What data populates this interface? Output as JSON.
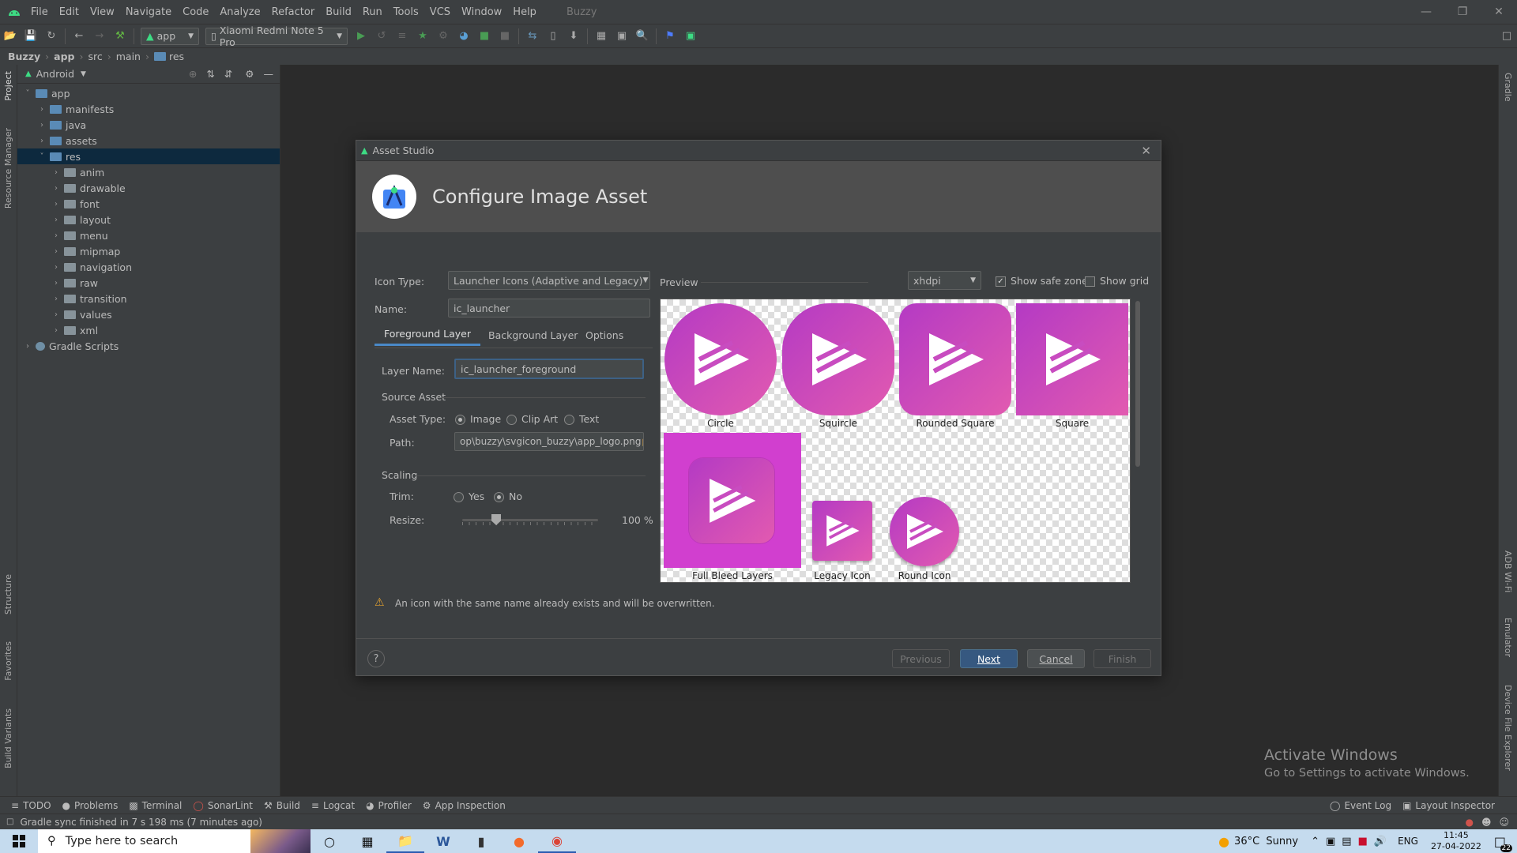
{
  "menubar": {
    "items": [
      "File",
      "Edit",
      "View",
      "Navigate",
      "Code",
      "Analyze",
      "Refactor",
      "Build",
      "Run",
      "Tools",
      "VCS",
      "Window",
      "Help"
    ],
    "project_name": "Buzzy"
  },
  "toolbar": {
    "module": "app",
    "device": "Xiaomi Redmi Note 5 Pro"
  },
  "breadcrumb": [
    "Buzzy",
    "app",
    "src",
    "main",
    "res"
  ],
  "project_panel": {
    "view_mode": "Android",
    "tree": [
      {
        "label": "app",
        "level": 0,
        "expanded": true
      },
      {
        "label": "manifests",
        "level": 1
      },
      {
        "label": "java",
        "level": 1
      },
      {
        "label": "assets",
        "level": 1
      },
      {
        "label": "res",
        "level": 1,
        "expanded": true,
        "selected": true
      },
      {
        "label": "anim",
        "level": 2
      },
      {
        "label": "drawable",
        "level": 2
      },
      {
        "label": "font",
        "level": 2
      },
      {
        "label": "layout",
        "level": 2
      },
      {
        "label": "menu",
        "level": 2
      },
      {
        "label": "mipmap",
        "level": 2
      },
      {
        "label": "navigation",
        "level": 2
      },
      {
        "label": "raw",
        "level": 2
      },
      {
        "label": "transition",
        "level": 2
      },
      {
        "label": "values",
        "level": 2
      },
      {
        "label": "xml",
        "level": 2
      },
      {
        "label": "Gradle Scripts",
        "level": 0
      }
    ]
  },
  "left_strip": {
    "project": "Project",
    "resource_manager": "Resource Manager",
    "structure": "Structure",
    "favorites": "Favorites",
    "build_variants": "Build Variants"
  },
  "right_strip": {
    "gradle": "Gradle",
    "adb_wifi": "ADB Wi-Fi",
    "emulator": "Emulator",
    "device_file_explorer": "Device File Explorer"
  },
  "dialog": {
    "window_title": "Asset Studio",
    "heading": "Configure Image Asset",
    "icon_type_label": "Icon Type:",
    "icon_type_value": "Launcher Icons (Adaptive and Legacy)",
    "name_label": "Name:",
    "name_value": "ic_launcher",
    "tabs": [
      "Foreground Layer",
      "Background Layer",
      "Options"
    ],
    "layer_name_label": "Layer Name:",
    "layer_name_value": "ic_launcher_foreground",
    "source_asset_label": "Source Asset",
    "asset_type_label": "Asset Type:",
    "asset_types": [
      "Image",
      "Clip Art",
      "Text"
    ],
    "path_label": "Path:",
    "path_value": "op\\buzzy\\svgicon_buzzy\\app_logo.png",
    "scaling_label": "Scaling",
    "trim_label": "Trim:",
    "trim_options": [
      "Yes",
      "No"
    ],
    "resize_label": "Resize:",
    "resize_value": "100 %",
    "resize_fraction": 0.25,
    "preview_label": "Preview",
    "density": "xhdpi",
    "show_safe_zone": "Show safe zone",
    "show_grid": "Show grid",
    "preview_items": [
      "Circle",
      "Squircle",
      "Rounded Square",
      "Square",
      "Full Bleed Layers",
      "Legacy Icon",
      "Round Icon"
    ],
    "warning": "An icon with the same name already exists and will be overwritten.",
    "buttons": {
      "help": "?",
      "previous": "Previous",
      "next": "Next",
      "cancel": "Cancel",
      "finish": "Finish"
    }
  },
  "bottom_tabs": [
    "TODO",
    "Problems",
    "Terminal",
    "SonarLint",
    "Build",
    "Logcat",
    "Profiler",
    "App Inspection"
  ],
  "bottom_right_tabs": [
    "Event Log",
    "Layout Inspector"
  ],
  "status_text": "Gradle sync finished in 7 s 198 ms (7 minutes ago)",
  "activate_windows": {
    "title": "Activate Windows",
    "subtitle": "Go to Settings to activate Windows."
  },
  "taskbar": {
    "search_placeholder": "Type here to search",
    "weather": "36°C  Sunny",
    "language": "ENG",
    "time": "11:45",
    "date": "27-04-2022",
    "notifications": "22"
  },
  "colors": {
    "icon_gradient_start": "#b43ac4",
    "icon_gradient_end": "#e25ab0",
    "selection": "#0d293e",
    "default_button": "#365880"
  }
}
